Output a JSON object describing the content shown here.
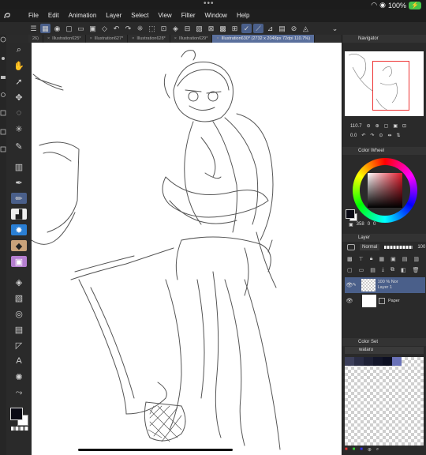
{
  "status_bar": {
    "dots": "•••",
    "battery": "100%"
  },
  "menu": {
    "items": [
      "File",
      "Edit",
      "Animation",
      "Layer",
      "Select",
      "View",
      "Filter",
      "Window",
      "Help"
    ]
  },
  "tabs": [
    {
      "label": "26)",
      "active": false
    },
    {
      "label": "Illustration625*",
      "active": false
    },
    {
      "label": "Illustration627*",
      "active": false
    },
    {
      "label": "Illustration628*",
      "active": false
    },
    {
      "label": "Illustration629*",
      "active": false
    },
    {
      "label": "Illustration630* (2732 x 2048px 72dpi 110.7%)",
      "active": true
    }
  ],
  "navigator": {
    "title": "Navigator",
    "zoom": "110.7",
    "rotation": "0.0"
  },
  "color_wheel": {
    "title": "Color Wheel",
    "h": "358",
    "s": "0",
    "v": "0",
    "main_color": "#0a0a14",
    "sub_color": "#ffffff"
  },
  "layer_panel": {
    "title": "Layer",
    "blend_mode": "Normal",
    "opacity": "100",
    "layers": [
      {
        "opacity_label": "100 %",
        "mode": "Nor",
        "name": "Layer 1",
        "selected": true
      },
      {
        "opacity_label": "",
        "mode": "",
        "name": "Paper",
        "selected": false
      }
    ]
  },
  "color_set": {
    "title": "Color Set",
    "set_name": "wataru",
    "swatches": [
      "#3c3f5a",
      "#2a2d45",
      "#1e2136",
      "#13162a",
      "#0c0f22",
      "#6a72b8"
    ]
  }
}
